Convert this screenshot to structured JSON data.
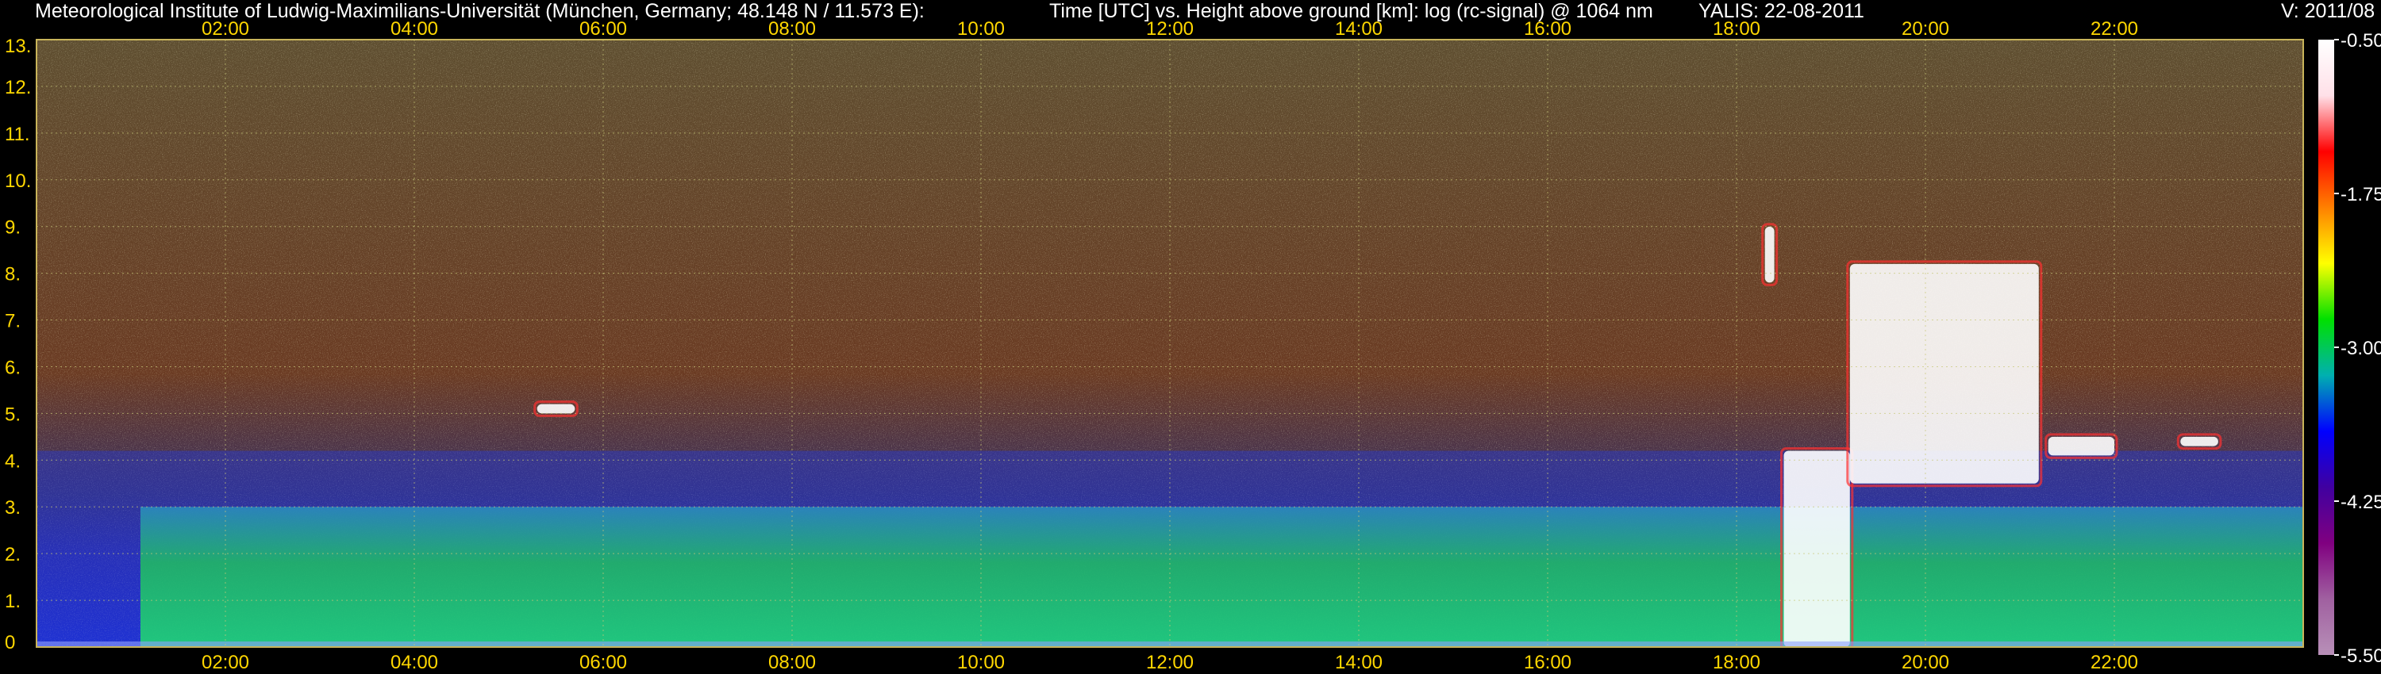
{
  "header": {
    "institute": "Meteorological Institute of Ludwig-Maximilians-Universität (München, Germany; 48.148 N / 11.573 E):",
    "description": "Time [UTC] vs. Height above ground [km]: log (rc-signal) @ 1064 nm",
    "instrument_date": "YALIS: 22-08-2011",
    "version": "V: 2011/08"
  },
  "colors": {
    "background": "#000000",
    "axis_text": "#ffd700",
    "header_text": "#ffffff",
    "grid": "#c8c878",
    "plot_frame": "#c8b45a"
  },
  "chart_data": {
    "type": "heatmap",
    "title": "Time [UTC] vs. Height above ground [km]: log (rc-signal) @ 1064 nm",
    "xlabel": "Time [UTC]",
    "ylabel": "Height above ground [km]",
    "x_ticks": [
      "02:00",
      "04:00",
      "06:00",
      "08:00",
      "10:00",
      "12:00",
      "14:00",
      "16:00",
      "18:00",
      "20:00",
      "22:00"
    ],
    "x_tick_hours": [
      2,
      4,
      6,
      8,
      10,
      12,
      14,
      16,
      18,
      20,
      22
    ],
    "xlim_hours": [
      0,
      24
    ],
    "y_ticks": [
      "0",
      "1.",
      "2.",
      "3.",
      "4.",
      "5.",
      "6.",
      "7.",
      "8.",
      "9.",
      "10.",
      "11.",
      "12.",
      "13."
    ],
    "y_tick_values": [
      0,
      1,
      2,
      3,
      4,
      5,
      6,
      7,
      8,
      9,
      10,
      11,
      12,
      13
    ],
    "ylim_km": [
      0,
      13
    ],
    "grid": true,
    "colorbar": {
      "ticks": [
        "-0.50",
        "-1.75",
        "-3.00",
        "-4.25",
        "-5.50"
      ],
      "tick_values": [
        -0.5,
        -1.75,
        -3.0,
        -4.25,
        -5.5
      ],
      "range": [
        -5.5,
        -0.5
      ],
      "colors": [
        "#ffffff",
        "#ffe0e8",
        "#ff0000",
        "#ff8000",
        "#ffff00",
        "#00e000",
        "#00b0b0",
        "#0000ff",
        "#4000a0",
        "#800080",
        "#a060a0",
        "#b890b8"
      ]
    },
    "features": [
      {
        "name": "boundary layer",
        "start_h": 1.1,
        "end_h": 24.0,
        "top_km": 3.0
      },
      {
        "name": "aerosol layer",
        "start_h": 0.0,
        "end_h": 24.0,
        "top_km": 4.2
      },
      {
        "name": "cloud",
        "start_h": 5.3,
        "end_h": 5.7,
        "base_km": 5.0,
        "top_km": 5.2
      },
      {
        "name": "cloud",
        "start_h": 18.3,
        "end_h": 18.4,
        "base_km": 7.8,
        "top_km": 9.0
      },
      {
        "name": "convective cloud",
        "start_h": 18.5,
        "end_h": 19.2,
        "base_km": 0.0,
        "top_km": 4.2
      },
      {
        "name": "cloud",
        "start_h": 19.2,
        "end_h": 21.2,
        "base_km": 3.5,
        "top_km": 8.2
      },
      {
        "name": "cloud",
        "start_h": 21.3,
        "end_h": 22.0,
        "base_km": 4.1,
        "top_km": 4.5
      },
      {
        "name": "cloud",
        "start_h": 22.7,
        "end_h": 23.1,
        "base_km": 4.3,
        "top_km": 4.5
      }
    ]
  }
}
